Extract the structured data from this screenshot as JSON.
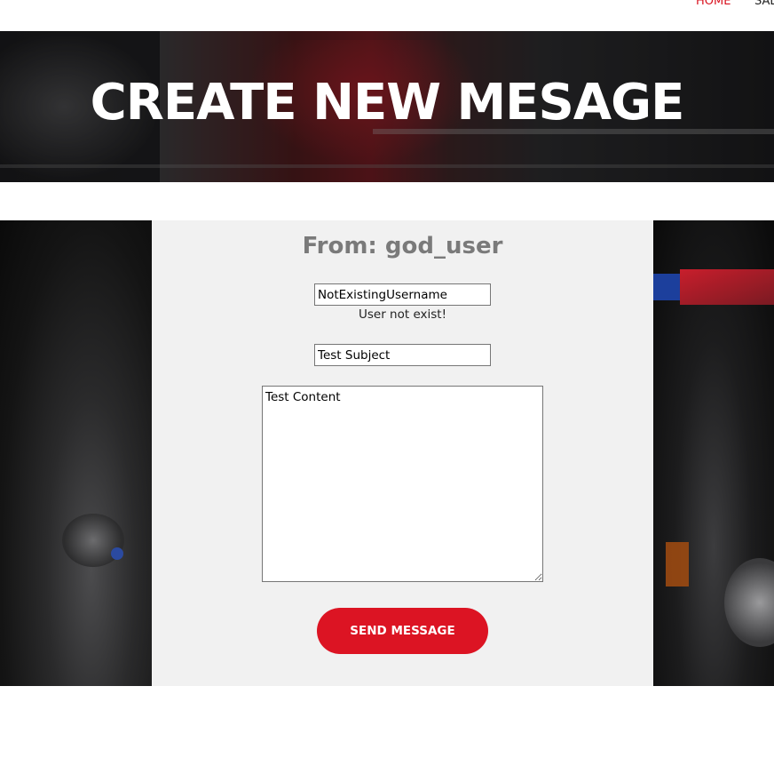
{
  "nav": {
    "items": [
      {
        "label": "HOME",
        "active": true
      },
      {
        "label": "SAL"
      }
    ],
    "accent_color": "#d9121f"
  },
  "hero": {
    "title": "CREATE NEW MESAGE"
  },
  "form": {
    "from_label": "From: god_user",
    "recipient_value": "NotExistingUsername",
    "recipient_error": "User not exist!",
    "subject_value": "Test Subject",
    "content_value": "Test Content",
    "send_button_label": "SEND MESSAGE",
    "button_color": "#dc1423"
  }
}
